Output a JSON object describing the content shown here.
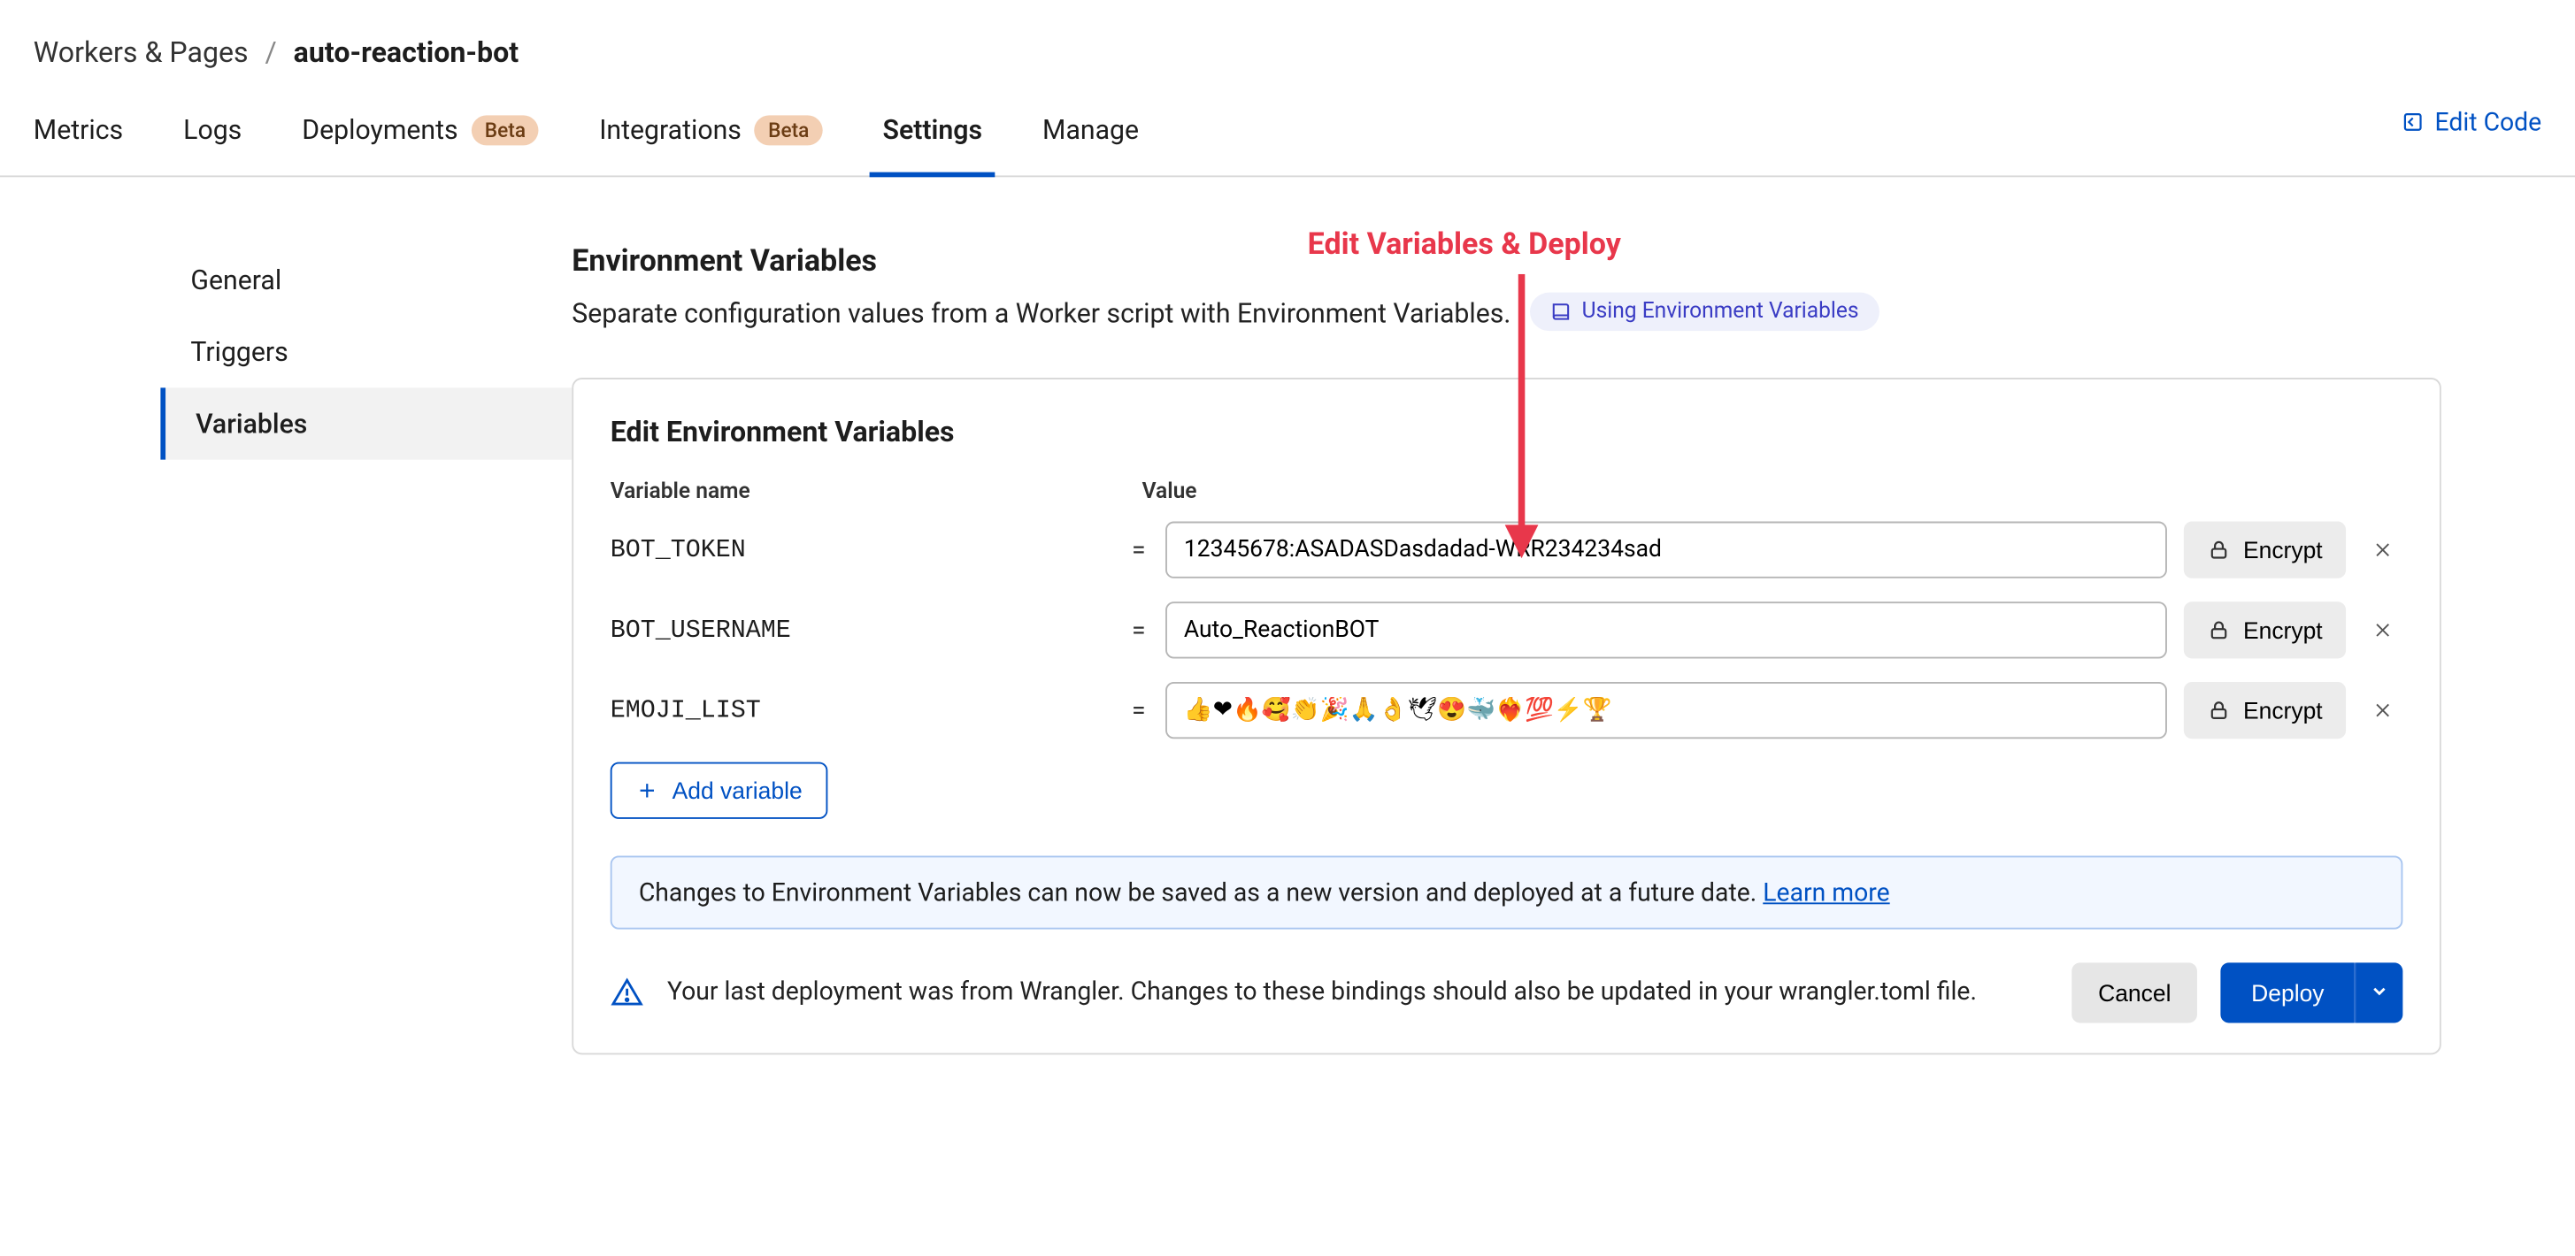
{
  "breadcrumb": {
    "parent": "Workers & Pages",
    "sep": "/",
    "current": "auto-reaction-bot"
  },
  "tabs": {
    "metrics": "Metrics",
    "logs": "Logs",
    "deployments": "Deployments",
    "deployments_badge": "Beta",
    "integrations": "Integrations",
    "integrations_badge": "Beta",
    "settings": "Settings",
    "manage": "Manage"
  },
  "edit_code": "Edit Code",
  "sidebar": {
    "general": "General",
    "triggers": "Triggers",
    "variables": "Variables"
  },
  "annotation": "Edit Variables & Deploy",
  "section": {
    "title": "Environment Variables",
    "desc": "Separate configuration values from a Worker script with Environment Variables.",
    "doc_link": "Using Environment Variables"
  },
  "panel": {
    "title": "Edit Environment Variables",
    "col_name": "Variable name",
    "col_value": "Value",
    "encrypt": "Encrypt",
    "vars": [
      {
        "name": "BOT_TOKEN",
        "value": "12345678:ASADASDasdadad-WRR234234sad"
      },
      {
        "name": "BOT_USERNAME",
        "value": "Auto_ReactionBOT"
      },
      {
        "name": "EMOJI_LIST",
        "value": "👍❤🔥🥰👏🎉🙏👌🕊😍🐳❤‍🔥💯⚡🏆"
      }
    ],
    "add_variable": "Add variable",
    "info_text": "Changes to Environment Variables can now be saved as a new version and deployed at a future date. ",
    "info_link": "Learn more",
    "warn": "Your last deployment was from Wrangler. Changes to these bindings should also be updated in your wrangler.toml file.",
    "cancel": "Cancel",
    "deploy": "Deploy"
  }
}
